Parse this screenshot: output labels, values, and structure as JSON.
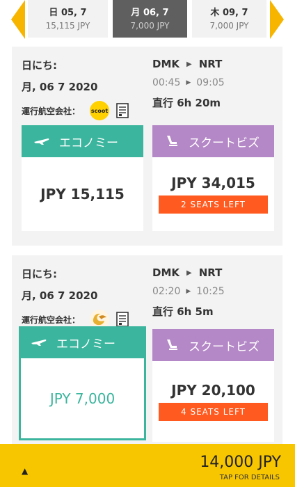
{
  "date_tabs": [
    {
      "date": "日 05, 7",
      "price": "15,115 JPY",
      "selected": false
    },
    {
      "date": "月 06, 7",
      "price": "7,000 JPY",
      "selected": true
    },
    {
      "date": "木 09, 7",
      "price": "7,000 JPY",
      "selected": false
    }
  ],
  "colors": {
    "accent": "#f7c600",
    "economy": "#3bb59d",
    "business": "#b487c6",
    "seats_badge": "#ff5a1f"
  },
  "flights": [
    {
      "date_label": "日にち:",
      "date_value": "月, 06 7 2020",
      "carrier_label": "運行航空会社：",
      "airline_logo": "scoot",
      "from": "DMK",
      "to": "NRT",
      "depart": "00:45",
      "arrive": "09:05",
      "duration": "直行 6h 20m",
      "economy": {
        "label": "エコノミー",
        "price": "JPY 15,115",
        "seats": ""
      },
      "business": {
        "label": "スクートビズ",
        "price": "JPY 34,015",
        "seats": "2 SEATS LEFT"
      }
    },
    {
      "date_label": "日にち:",
      "date_value": "月, 06 7 2020",
      "carrier_label": "運行航空会社：",
      "airline_logo": "",
      "from": "DMK",
      "to": "NRT",
      "depart": "02:20",
      "arrive": "10:25",
      "duration": "直行 6h 5m",
      "economy": {
        "label": "エコノミー",
        "price": "JPY 7,000",
        "seats": ""
      },
      "business": {
        "label": "スクートビズ",
        "price": "JPY 20,100",
        "seats": "4 SEATS LEFT"
      }
    }
  ],
  "bottom_bar": {
    "total": "14,000 JPY",
    "tap": "TAP FOR DETAILS"
  }
}
